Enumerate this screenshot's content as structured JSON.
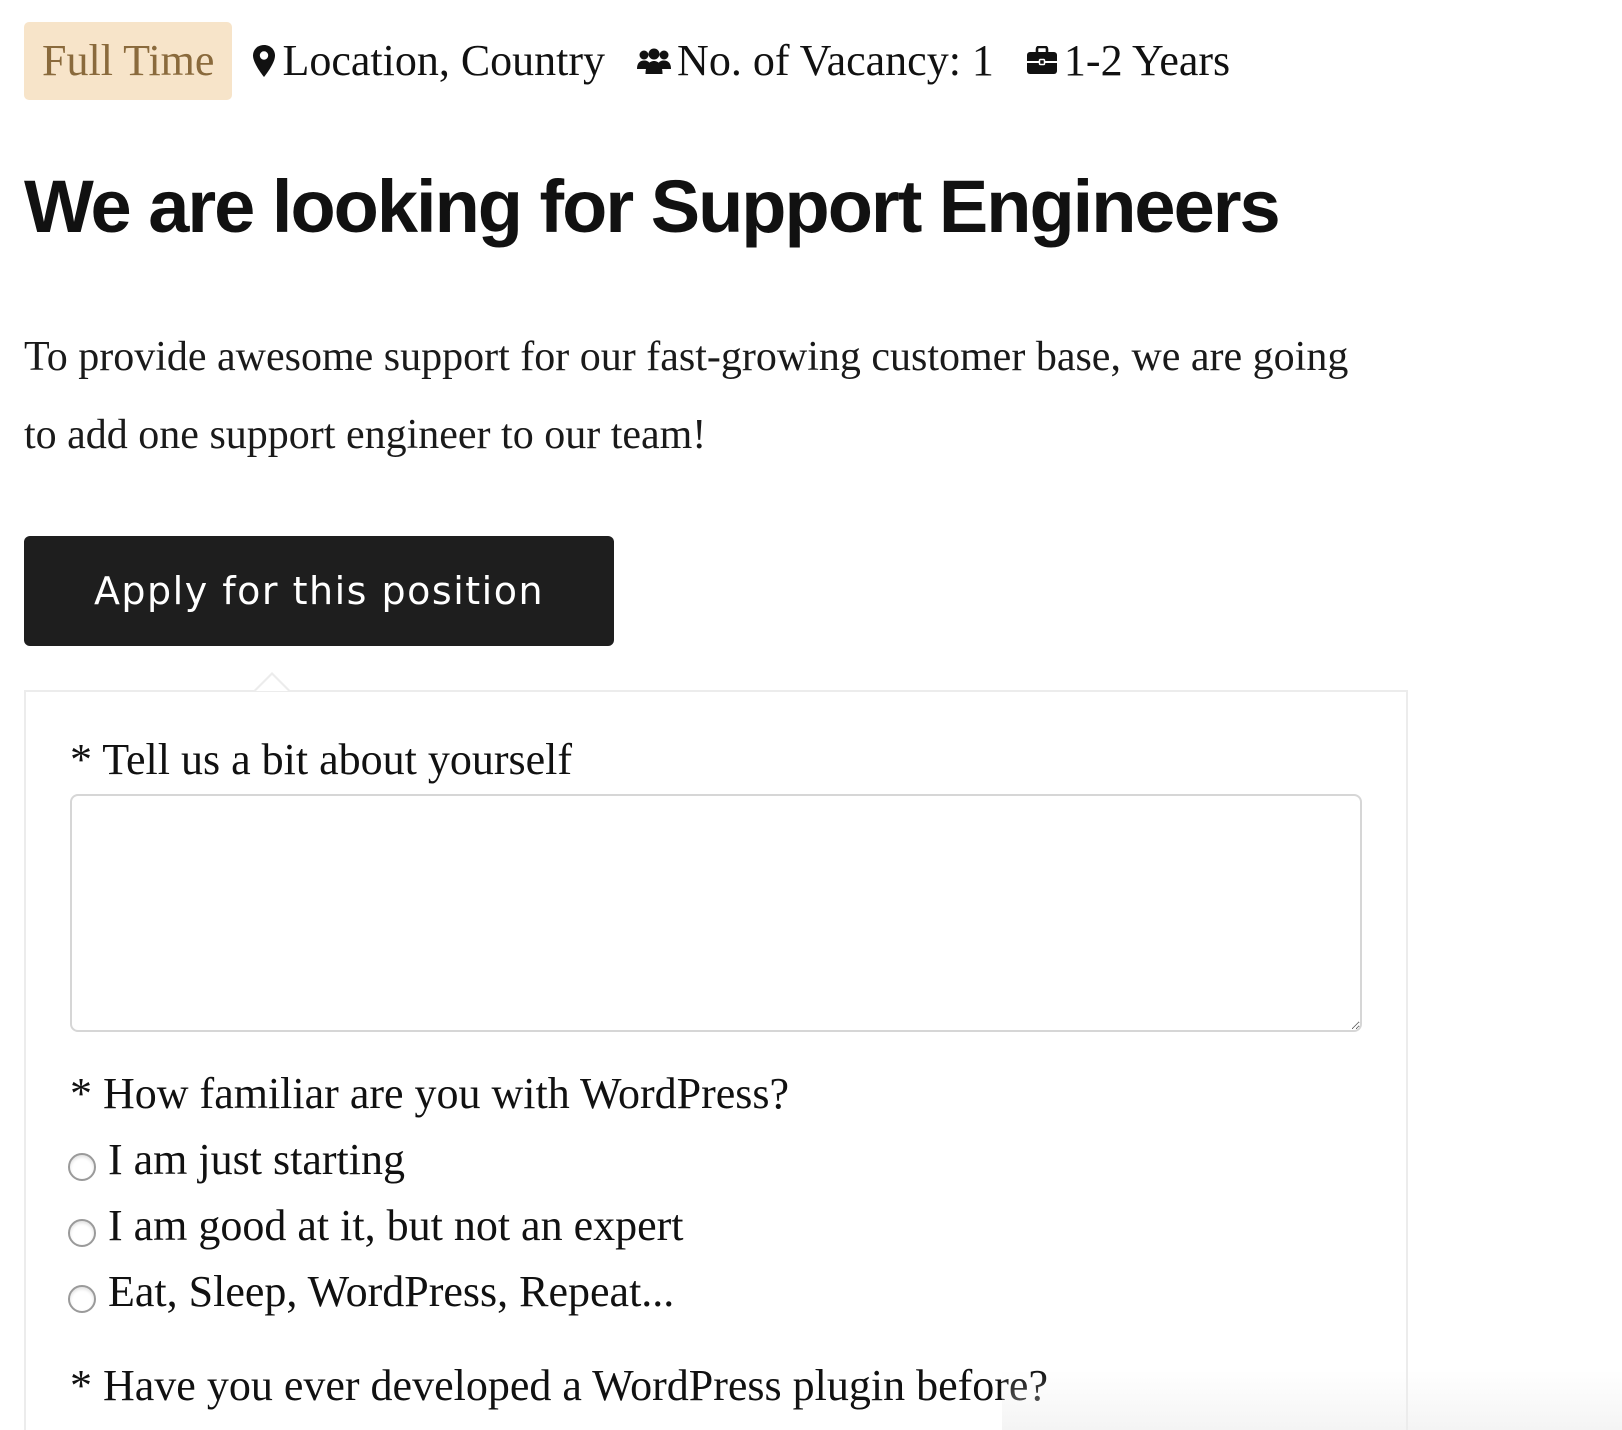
{
  "meta": {
    "job_type": "Full Time",
    "location": "Location, Country",
    "vacancy": "No. of Vacancy: 1",
    "experience": "1-2 Years",
    "icons": {
      "location": "map-pin-icon",
      "vacancy": "users-icon",
      "experience": "briefcase-icon"
    },
    "badge_colors": {
      "background": "#f7e4c9",
      "text": "#8a6a3c"
    }
  },
  "job": {
    "title": "We are looking for Support Engineers",
    "description": "To provide awesome support for our fast-growing customer base, we are going to add one support engineer to our team!"
  },
  "apply_button": {
    "label": "Apply for this position",
    "background": "#1e1e1e"
  },
  "form": {
    "question_about": "* Tell us a bit about yourself",
    "about_value": "",
    "question_wordpress": "* How familiar are you with WordPress?",
    "wordpress_options": [
      "I am just starting",
      "I am good at it, but not an expert",
      "Eat, Sleep, WordPress, Repeat..."
    ],
    "question_plugin": "* Have you ever developed a WordPress plugin before?"
  }
}
